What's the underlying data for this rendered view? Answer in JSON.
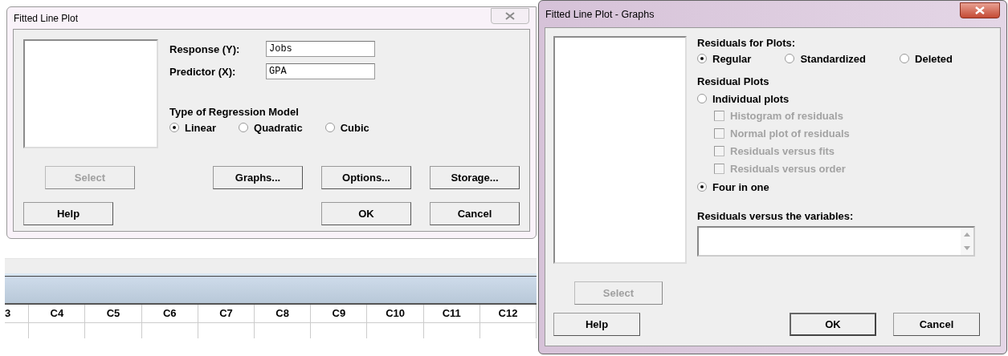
{
  "left_dialog": {
    "title": "Fitted Line Plot",
    "fields": [
      {
        "label": "Response (Y):",
        "value": "Jobs"
      },
      {
        "label": "Predictor (X):",
        "value": "GPA"
      }
    ],
    "model_group": {
      "label": "Type of Regression Model",
      "options": [
        {
          "label": "Linear",
          "selected": true
        },
        {
          "label": "Quadratic",
          "selected": false
        },
        {
          "label": "Cubic",
          "selected": false
        }
      ]
    },
    "button_rows": [
      {
        "left_buttons": [
          {
            "label": "Select",
            "disabled": true
          }
        ],
        "right_buttons": [
          {
            "label": "Graphs...",
            "disabled": false
          },
          {
            "label": "Options...",
            "disabled": false
          },
          {
            "label": "Storage...",
            "disabled": false
          }
        ]
      },
      {
        "left_buttons": [
          {
            "label": "Help",
            "disabled": false
          }
        ],
        "right_buttons": [
          {
            "label": "OK",
            "disabled": false
          },
          {
            "label": "Cancel",
            "disabled": false
          }
        ]
      }
    ]
  },
  "worksheet": {
    "columns": [
      "3",
      "C4",
      "C5",
      "C6",
      "C7",
      "C8",
      "C9",
      "C10",
      "C11",
      "C12"
    ]
  },
  "right_dialog": {
    "title": "Fitted Line Plot - Graphs",
    "residuals_for_plots": {
      "label": "Residuals for Plots:",
      "options": [
        {
          "label": "Regular",
          "selected": true
        },
        {
          "label": "Standardized",
          "selected": false
        },
        {
          "label": "Deleted",
          "selected": false
        }
      ]
    },
    "residual_plots": {
      "label": "Residual Plots",
      "options": [
        {
          "label": "Individual plots",
          "selected": false,
          "children": [
            {
              "label": "Histogram of residuals",
              "checked": false,
              "disabled": true
            },
            {
              "label": "Normal plot of residuals",
              "checked": false,
              "disabled": true
            },
            {
              "label": "Residuals versus fits",
              "checked": false,
              "disabled": true
            },
            {
              "label": "Residuals versus order",
              "checked": false,
              "disabled": true
            }
          ]
        },
        {
          "label": "Four in one",
          "selected": true
        }
      ]
    },
    "variables_field": {
      "label": "Residuals versus the variables:"
    },
    "select_button": {
      "label": "Select",
      "disabled": true
    },
    "left_buttons": [
      {
        "label": "Help",
        "disabled": false
      }
    ],
    "right_buttons": [
      {
        "label": "OK",
        "disabled": false
      },
      {
        "label": "Cancel",
        "disabled": false
      }
    ]
  }
}
